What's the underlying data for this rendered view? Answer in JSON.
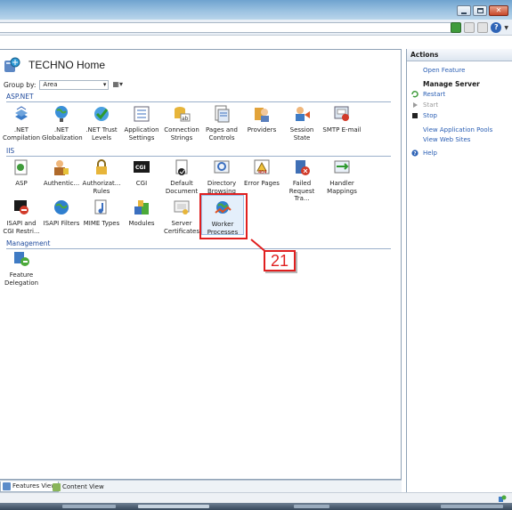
{
  "header": {
    "title": "TECHNO Home"
  },
  "group_by": {
    "label": "Group by:",
    "value": "Area"
  },
  "sections": [
    {
      "name": "ASP.NET"
    },
    {
      "name": "IIS"
    },
    {
      "name": "Management"
    }
  ],
  "features": {
    "net_compilation": ".NET\nCompilation",
    "net_globalization": ".NET\nGlobalization",
    "net_trust_levels": ".NET Trust\nLevels",
    "application_settings": "Application\nSettings",
    "connection_strings": "Connection\nStrings",
    "pages_and_controls": "Pages and\nControls",
    "providers": "Providers",
    "session_state": "Session State",
    "smtp_email": "SMTP E-mail",
    "asp": "ASP",
    "authentication": "Authentic...",
    "authorization_rules": "Authorizat...\nRules",
    "cgi": "CGI",
    "default_document": "Default\nDocument",
    "directory_browsing": "Directory\nBrowsing",
    "error_pages": "Error Pages",
    "failed_request_tracing": "Failed\nRequest Tra...",
    "handler_mappings": "Handler\nMappings",
    "isapi_cgi_restrictions": "ISAPI and\nCGI Restri...",
    "isapi_filters": "ISAPI Filters",
    "mime_types": "MIME Types",
    "modules": "Modules",
    "server_certificates": "Server\nCertificates",
    "worker_processes": "Worker\nProcesses",
    "feature_delegation": "Feature\nDelegation"
  },
  "callout": {
    "number": "21"
  },
  "bottom_tabs": {
    "features_view": "Features View",
    "content_view": "Content View"
  },
  "actions": {
    "title": "Actions",
    "open_feature": "Open Feature",
    "manage_server": "Manage Server",
    "restart": "Restart",
    "start": "Start",
    "stop": "Stop",
    "view_application_pools": "View Application Pools",
    "view_web_sites": "View Web Sites",
    "help": "Help"
  },
  "colors": {
    "accent": "#2b5fb4",
    "callout_red": "#e01f1f",
    "section_blue": "#1f4a9c"
  }
}
